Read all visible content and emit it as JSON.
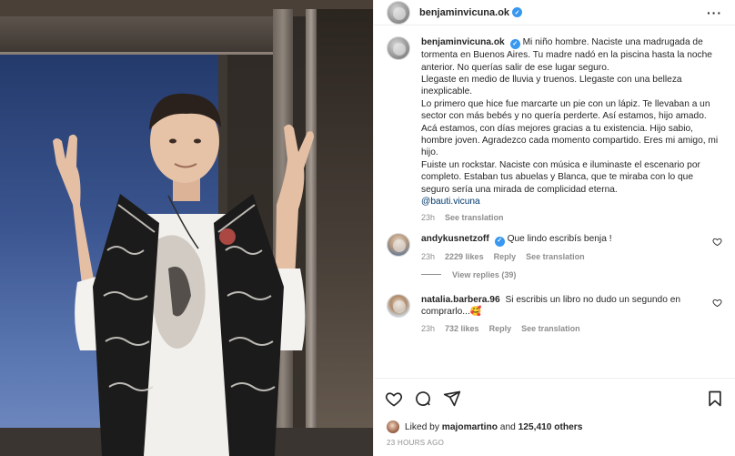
{
  "post": {
    "username": "benjaminvicuna.ok",
    "verified": true,
    "avatar_icon": "avatar-icon"
  },
  "caption": {
    "username": "benjaminvicuna.ok",
    "paragraphs": [
      "Mi niño hombre. Naciste una madrugada de tormenta en Buenos Aires. Tu madre nadó en la piscina hasta la noche anterior. No querías salir de ese lugar seguro.",
      "Llegaste en medio de lluvia y truenos. Llegaste con una belleza inexplicable.",
      "Lo primero que hice fue marcarte un pie con un lápiz. Te llevaban a un sector con más bebés y no quería perderte. Así estamos, hijo amado. Acá estamos, con días mejores gracias a tu existencia. Hijo sabio, hombre joven. Agradezco cada momento compartido. Eres mi amigo, mi hijo.",
      "Fuiste un rockstar. Naciste con música e iluminaste el escenario por completo. Estaban tus abuelas y Blanca, que te miraba con lo que seguro sería una mirada de complicidad eterna."
    ],
    "mention": "@bauti.vicuna",
    "time": "23h",
    "see_translation": "See translation"
  },
  "comments": [
    {
      "username": "andykusnetzoff",
      "verified": true,
      "text": "Que lindo escribís benja !",
      "time": "23h",
      "likes": "2229 likes",
      "reply": "Reply",
      "see_translation": "See translation",
      "view_replies": "View replies (39)"
    },
    {
      "username": "natalia.barbera.96",
      "verified": false,
      "text": "Si escribis un libro no dudo un segundo en comprarlo...🥰",
      "time": "23h",
      "likes": "732 likes",
      "reply": "Reply",
      "see_translation": "See translation"
    }
  ],
  "actions": {
    "like_icon": "heart-icon",
    "comment_icon": "comment-icon",
    "share_icon": "share-icon",
    "save_icon": "bookmark-icon"
  },
  "likes": {
    "prefix": "Liked by",
    "first_user": "majomartino",
    "connector": "and",
    "others": "125,410 others"
  },
  "timestamp": "23 HOURS AGO",
  "colors": {
    "verified": "#3897f0",
    "secondary_text": "#8e8e8e",
    "primary_text": "#262626",
    "link": "#00376b"
  }
}
